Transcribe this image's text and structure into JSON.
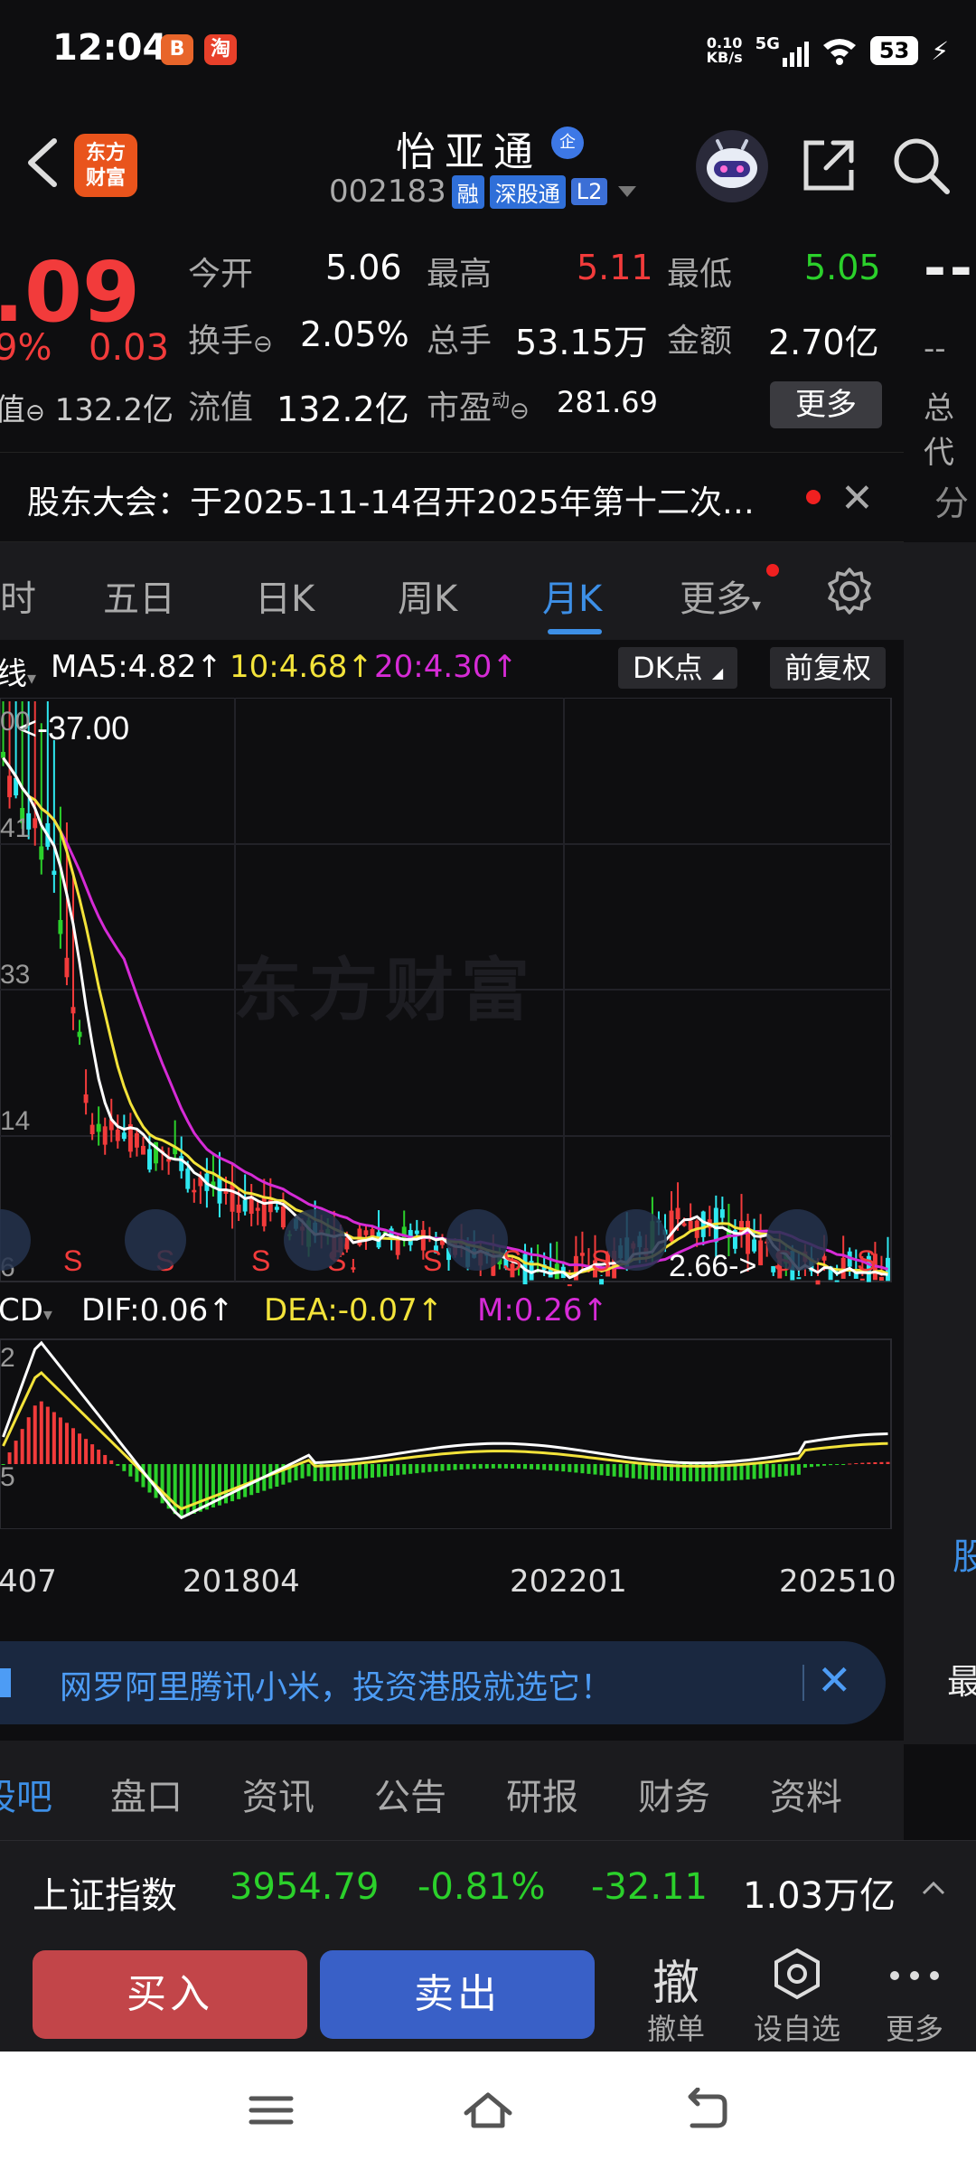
{
  "status_bar": {
    "time": "12:04",
    "app_icons": [
      "bilibili-icon",
      "taobao-icon"
    ],
    "net_speed_value": "0.10",
    "net_speed_unit": "KB/s",
    "network": "5G",
    "battery": "53"
  },
  "header": {
    "logo_line1": "东方",
    "logo_line2": "财富",
    "stock_name": "怡亚通",
    "qi_badge": "企",
    "stock_code": "002183",
    "tags": [
      "融",
      "深股通",
      "L2"
    ]
  },
  "quote": {
    "price": ".09",
    "change_pct": "9%",
    "change": "0.03",
    "market_cap_label": "值",
    "market_cap": "132.2亿",
    "open_label": "今开",
    "open": "5.06",
    "high_label": "最高",
    "high": "5.11",
    "low_label": "最低",
    "low": "5.05",
    "turnover_label": "换手",
    "turnover": "2.05%",
    "volume_label": "总手",
    "volume": "53.15万",
    "amount_label": "金额",
    "amount": "2.70亿",
    "float_cap_label": "流值",
    "float_cap": "132.2亿",
    "pe_label": "市盈",
    "pe_sup": "动",
    "pe": "281.69",
    "more_label": "更多",
    "side_dash": "--",
    "side_dash2": "--",
    "side_label": "总代"
  },
  "notice": {
    "text": "股东大会：于2025-11-14召开2025年第十二次…",
    "side_label": "分"
  },
  "periods": {
    "items": [
      "时",
      "五日",
      "日K",
      "周K",
      "月K",
      "更多"
    ],
    "active": "月K"
  },
  "ma_row": {
    "prefix": "线",
    "ma5": "MA5:4.82↑",
    "ma10": "10:4.68↑",
    "ma20": "20:4.30↑",
    "dk_label": "DK点",
    "fq_label": "前复权"
  },
  "chart": {
    "watermark": "东方财富",
    "max_label": "<-37.00",
    "min_label": "2.66->",
    "y_ticks": [
      "00",
      "41",
      "33",
      "14",
      "6"
    ],
    "signal": "S"
  },
  "macd": {
    "prefix": "CD",
    "dif": "DIF:0.06↑",
    "dea": "DEA:-0.07↑",
    "m": "M:0.26↑",
    "y_ticks": [
      "2",
      "5"
    ]
  },
  "x_axis": [
    "407",
    "201804",
    "202201",
    "202510"
  ],
  "colors": {
    "red": "#f23b3b",
    "green": "#2bd12b",
    "blue": "#3d8fe6",
    "ma5": "#ffffff",
    "ma10": "#f3e33a",
    "ma20": "#d62bd6",
    "cyan": "#2ee8f0"
  },
  "promo": {
    "text": "网罗阿里腾讯小米，投资港股就选它！"
  },
  "bottom_tabs": [
    "股吧",
    "盘口",
    "资讯",
    "公告",
    "研报",
    "财务",
    "资料"
  ],
  "right_panel": {
    "tab_label": "股",
    "label": "最"
  },
  "index_bar": {
    "name": "上证指数",
    "value": "3954.79",
    "pct": "-0.81%",
    "change": "-32.11",
    "amount": "1.03万亿"
  },
  "actions": {
    "buy": "买入",
    "sell": "卖出",
    "cancel_icon": "撤",
    "cancel": "撤单",
    "watchlist": "设自选",
    "more": "更多"
  }
}
